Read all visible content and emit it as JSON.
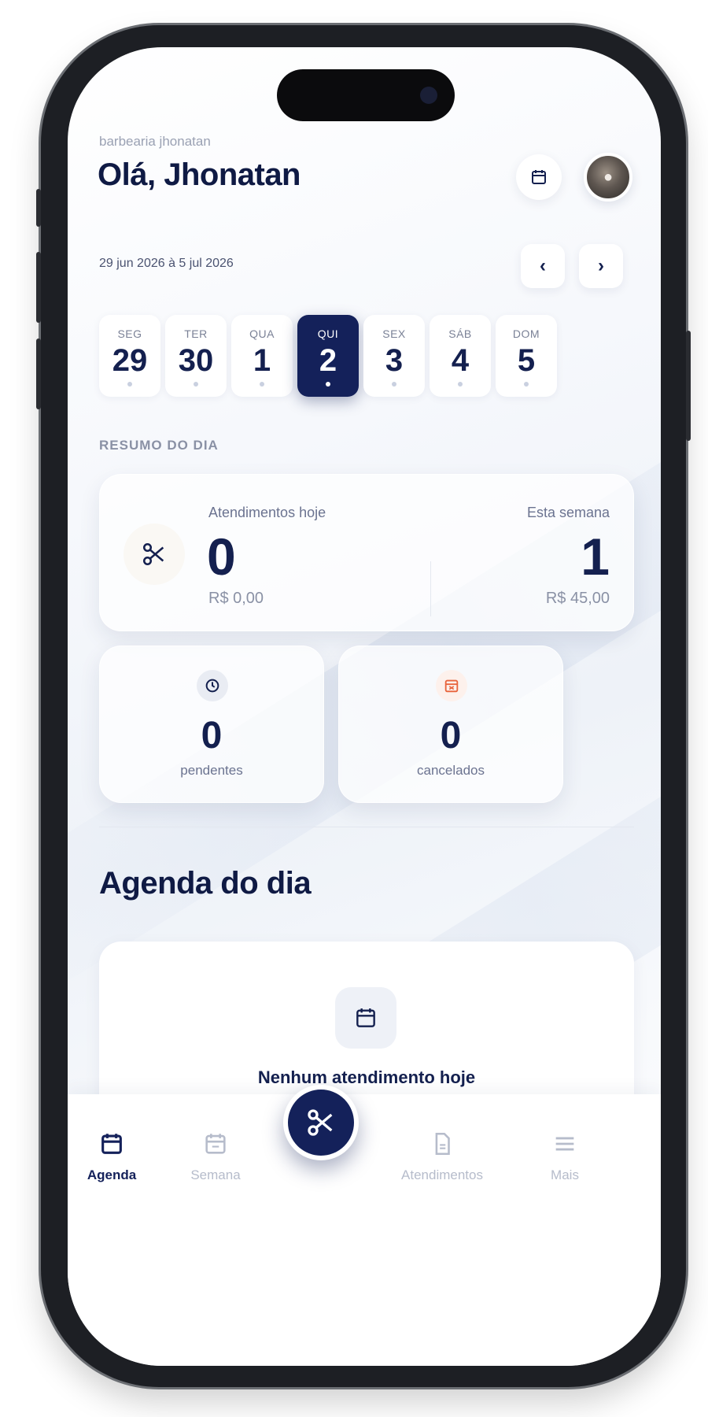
{
  "header": {
    "brand": "barbearia jhonatan",
    "greeting": "Olá, Jhonatan"
  },
  "week": {
    "range": "29 jun 2026 à 5 jul 2026",
    "days": [
      {
        "weekday": "SEG",
        "num": "29"
      },
      {
        "weekday": "TER",
        "num": "30"
      },
      {
        "weekday": "QUA",
        "num": "1"
      },
      {
        "weekday": "QUI",
        "num": "2"
      },
      {
        "weekday": "SEX",
        "num": "3"
      },
      {
        "weekday": "SÁB",
        "num": "4"
      },
      {
        "weekday": "DOM",
        "num": "5"
      }
    ],
    "selected_index": 3
  },
  "summary": {
    "section_label": "RESUMO DO DIA",
    "today_label": "Atendimentos hoje",
    "today_count": "0",
    "today_amount": "R$ 0,00",
    "week_label": "Esta semana",
    "week_count": "1",
    "week_amount": "R$ 45,00",
    "pending_count": "0",
    "pending_label": "pendentes",
    "cancelled_count": "0",
    "cancelled_label": "cancelados"
  },
  "agenda": {
    "title": "Agenda do dia",
    "empty_title": "Nenhum atendimento hoje"
  },
  "tabbar": {
    "tabs": [
      {
        "label": "Agenda",
        "icon": "calendar-icon"
      },
      {
        "label": "Semana",
        "icon": "calendar-week-icon"
      },
      {
        "label": "Atendimentos",
        "icon": "document-icon"
      },
      {
        "label": "Mais",
        "icon": "menu-icon"
      }
    ],
    "active_index": 0,
    "center_action_icon": "scissors-icon"
  },
  "colors": {
    "accent": "#14215a",
    "pending": "#14204f",
    "cancelled": "#e8643c"
  }
}
